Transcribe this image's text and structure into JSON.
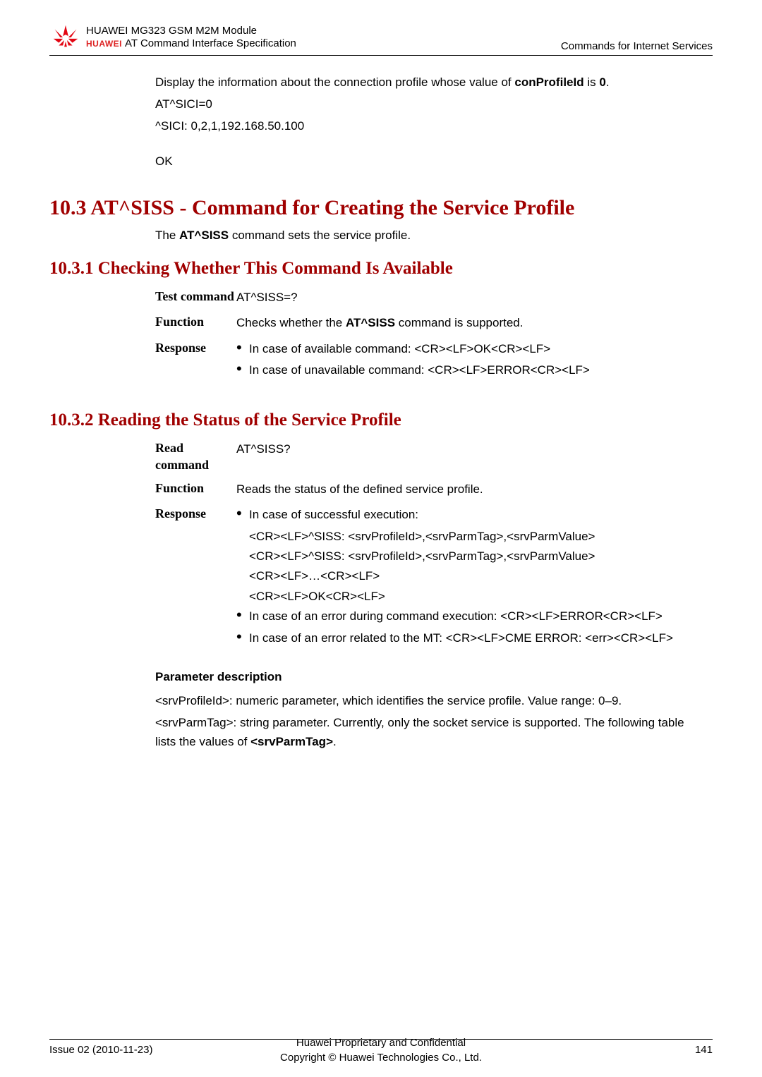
{
  "header": {
    "brand": "HUAWEI",
    "line1": "HUAWEI MG323 GSM M2M Module",
    "line2": "AT Command Interface Specification",
    "right": "Commands for Internet Services"
  },
  "intro": {
    "line1_pre": "Display the information about the connection profile whose value of ",
    "line1_bold": "conProfileId",
    "line1_mid": " is ",
    "line1_bold2": "0",
    "line1_post": ".",
    "line2": "AT^SICI=0",
    "line3": "^SICI: 0,2,1,192.168.50.100",
    "ok": "OK"
  },
  "section103": {
    "title": "10.3 AT^SISS - Command for Creating the Service Profile",
    "sub_pre": "The ",
    "sub_bold": "AT^SISS",
    "sub_post": " command sets the service profile."
  },
  "sub1031": {
    "title": "10.3.1 Checking Whether This Command Is Available",
    "rows": {
      "test_label": "Test command",
      "test_value": "AT^SISS=?",
      "func_label": "Function",
      "func_pre": "Checks whether the ",
      "func_bold": "AT^SISS",
      "func_post": " command is supported.",
      "resp_label": "Response",
      "resp_items": [
        "In case of available command: <CR><LF>OK<CR><LF>",
        "In case of unavailable command: <CR><LF>ERROR<CR><LF>"
      ]
    }
  },
  "sub1032": {
    "title": "10.3.2 Reading the Status of the Service Profile",
    "rows": {
      "read_label": "Read command",
      "read_value": "AT^SISS?",
      "func_label": "Function",
      "func_value": "Reads the status of the defined service profile.",
      "resp_label": "Response",
      "bullet1": "In case of successful execution:",
      "sub_lines": [
        "<CR><LF>^SISS: <srvProfileId>,<srvParmTag>,<srvParmValue>",
        "<CR><LF>^SISS: <srvProfileId>,<srvParmTag>,<srvParmValue>",
        "<CR><LF>…<CR><LF>",
        "<CR><LF>OK<CR><LF>"
      ],
      "bullet2": "In case of an error during command execution: <CR><LF>ERROR<CR><LF>",
      "bullet3": "In case of an error related to the MT: <CR><LF>CME ERROR: <err><CR><LF>"
    }
  },
  "paramdesc": {
    "heading": "Parameter description",
    "p1": "<srvProfileId>: numeric parameter, which identifies the service profile. Value range: 0–9.",
    "p2_pre": "<srvParmTag>: string parameter. Currently, only the socket service is supported. The following table lists the values of ",
    "p2_bold": "<srvParmTag>",
    "p2_post": "."
  },
  "footer": {
    "left": "Issue 02 (2010-11-23)",
    "center1": "Huawei Proprietary and Confidential",
    "center2": "Copyright © Huawei Technologies Co., Ltd.",
    "right": "141"
  }
}
